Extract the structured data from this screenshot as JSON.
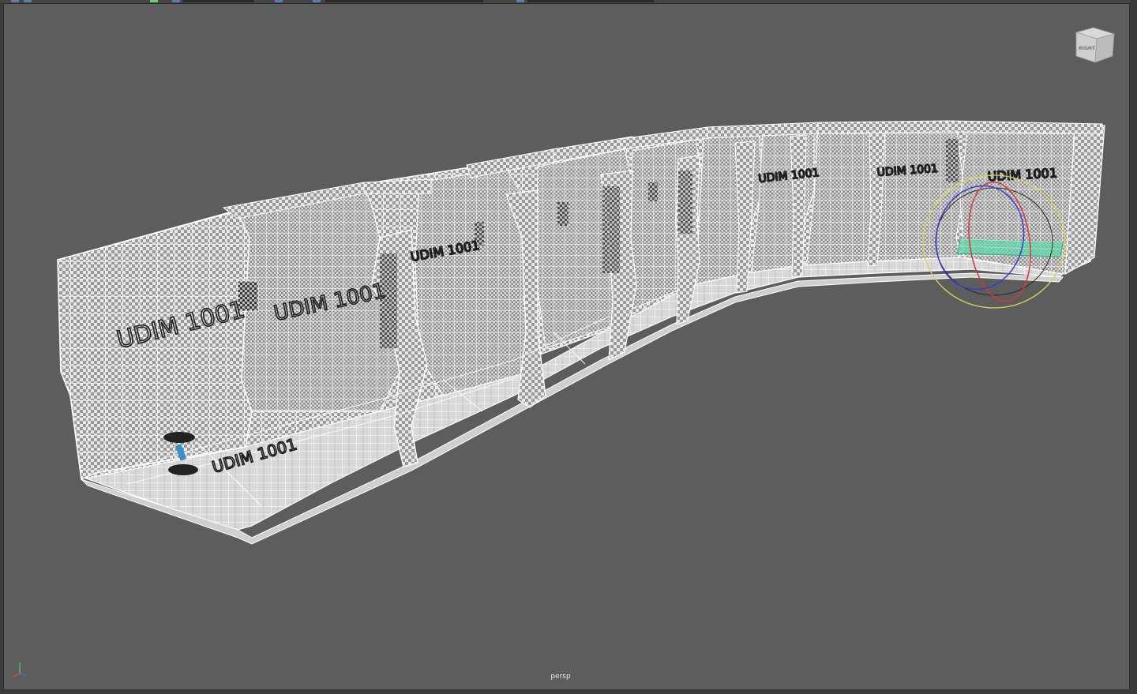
{
  "viewport": {
    "camera_label": "persp",
    "background_color": "#5d5d5d"
  },
  "view_cube": {
    "face_label": "RIGHT"
  },
  "mesh": {
    "uv_texture_text": "UDIM 1001"
  },
  "manipulator": {
    "rings": [
      "yellow",
      "red",
      "blue"
    ],
    "selection_color": "#5fd6a8"
  },
  "icons": [
    "view-cube-icon",
    "axis-indicator-icon",
    "rotate-manipulator-icon"
  ]
}
